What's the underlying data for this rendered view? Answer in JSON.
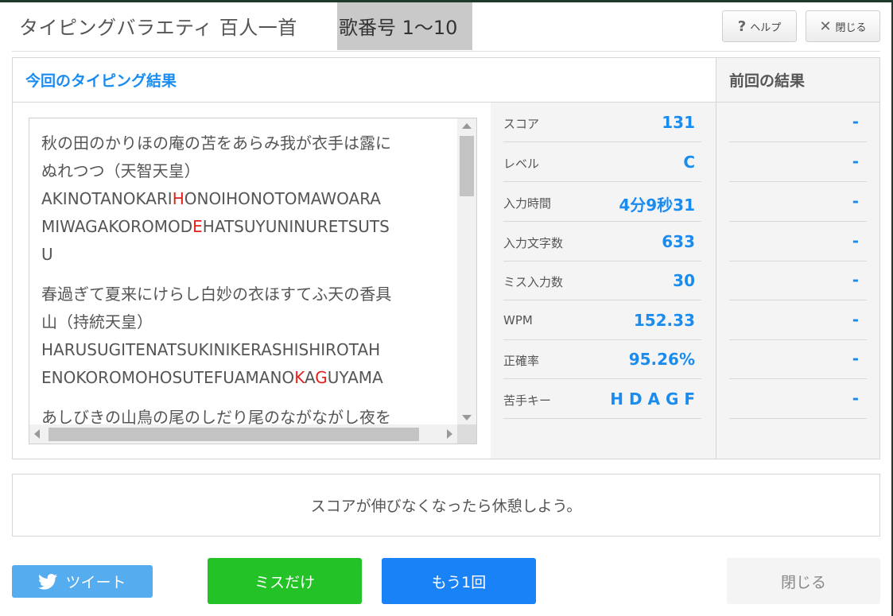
{
  "header": {
    "title": "タイピングバラエティ 百人一首",
    "title_highlight": "歌番号 1〜10",
    "help_label": "ヘルプ",
    "close_label": "閉じる"
  },
  "results": {
    "current_heading": "今回のタイピング結果",
    "previous_heading": "前回の結果",
    "stats": [
      {
        "label": "スコア",
        "value": "131",
        "previous": "-"
      },
      {
        "label": "レベル",
        "value": "C",
        "previous": "-"
      },
      {
        "label": "入力時間",
        "value": "4分9秒31",
        "previous": "-"
      },
      {
        "label": "入力文字数",
        "value": "633",
        "previous": "-"
      },
      {
        "label": "ミス入力数",
        "value": "30",
        "previous": "-"
      },
      {
        "label": "WPM",
        "value": "152.33",
        "previous": "-"
      },
      {
        "label": "正確率",
        "value": "95.26%",
        "previous": "-"
      },
      {
        "label": "苦手キー",
        "value": "H D A G F",
        "previous": "-"
      }
    ]
  },
  "poems": [
    {
      "jp1": "秋の田のかりほの庵の苫をあらみ我が衣手は露に",
      "jp2": "ぬれつつ（天智天皇）",
      "r1a": "AKINOTANOKARI",
      "r1b": "H",
      "r1c": "ONOIHONOTOMAWOARA",
      "r2a": "MIWAGAKOROMOD",
      "r2b": "E",
      "r2c": "HATSUYUNINURETSUTS",
      "r3": "U"
    },
    {
      "jp1": "春過ぎて夏来にけらし白妙の衣ほすてふ天の香具",
      "jp2": "山（持統天皇）",
      "r1": "HARUSUGITENATSUKINIKERASHISHIROTAH",
      "r2a": "ENOKOROMOHOSUTEFUAMANO",
      "r2b": "K",
      "r2c": "A",
      "r2d": "G",
      "r2e": "UYAMA"
    },
    {
      "jp1": "あしびきの山鳥の尾のしだり尾のながながし夜を"
    }
  ],
  "message": "スコアが伸びなくなったら休憩しよう。",
  "buttons": {
    "tweet": "ツイート",
    "miss_only": "ミスだけ",
    "retry": "もう1回",
    "close": "閉じる"
  }
}
